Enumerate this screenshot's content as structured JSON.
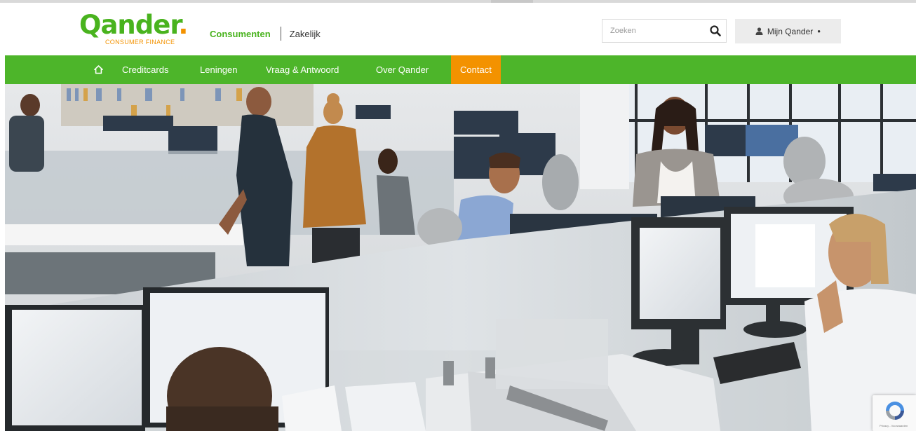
{
  "brand": {
    "name": "Qander",
    "dot": ".",
    "tagline": "CONSUMER FINANCE",
    "green": "#49b31e",
    "orange": "#f39200"
  },
  "segments": {
    "active": "Consumenten",
    "inactive": "Zakelijk"
  },
  "search": {
    "placeholder": "Zoeken",
    "icon": "search-icon"
  },
  "account": {
    "label": "Mijn Qander",
    "icon": "user-icon",
    "indicator": "●"
  },
  "nav": {
    "home_icon": "home-icon",
    "items": [
      {
        "label": "Creditcards"
      },
      {
        "label": "Leningen"
      },
      {
        "label": "Vraag & Antwoord"
      },
      {
        "label": "Over Qander"
      },
      {
        "label": "Contact",
        "active": true
      }
    ]
  },
  "hero": {
    "image": "office-workers-photo"
  },
  "recaptcha": {
    "icon": "recaptcha-icon",
    "legal": "Privacy - Voorwaarden"
  }
}
